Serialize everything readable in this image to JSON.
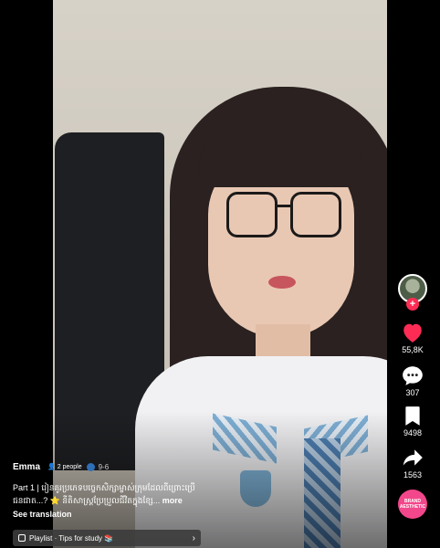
{
  "video": {
    "author": "Emma",
    "viewers": "2 people",
    "date": "9-6",
    "caption_text": "Part 1 | រៀនគូរប្រភេទបច្ចេកសិក្សាម្ចាស់ក្រុមដែលពីព្រោះប្រើជនជាត...? ⭐ នីតិសាស្ត្រប្រែប្រួលជីវិតក្នុងខ្សែ...",
    "more_label": "more",
    "see_translation": "See translation",
    "playlist_label": "Playlist · Tips for study 📚"
  },
  "actions": {
    "like_count": "55,8K",
    "comment_count": "307",
    "save_count": "9498",
    "share_count": "1563",
    "disc_text": "BRAND AESTHETIC"
  },
  "colors": {
    "like": "#fe2c55",
    "disc": "#f3478b"
  }
}
